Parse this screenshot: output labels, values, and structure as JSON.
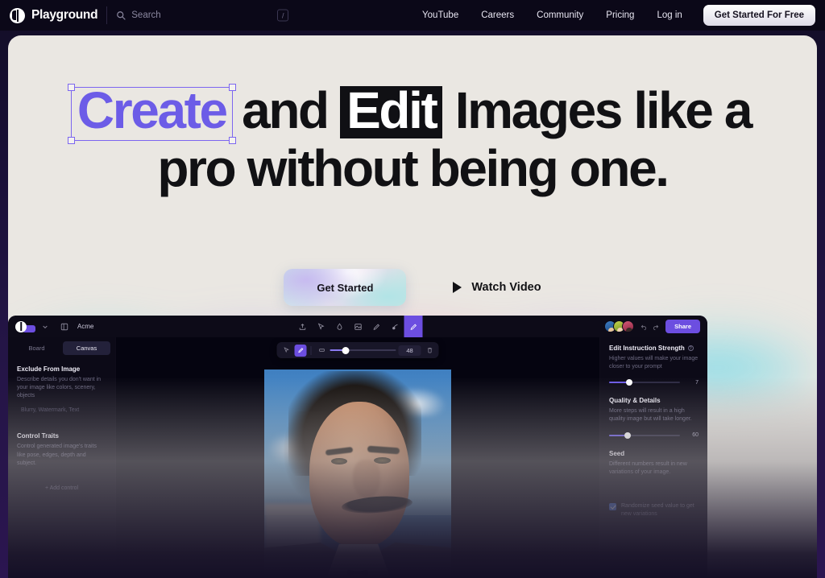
{
  "nav": {
    "brand": "Playground",
    "brand_logo_icon": "playground-logo-icon",
    "search": {
      "placeholder": "Search",
      "icon": "search-icon",
      "shortcut": "/"
    },
    "links": [
      {
        "label": "YouTube"
      },
      {
        "label": "Careers"
      },
      {
        "label": "Community"
      },
      {
        "label": "Pricing"
      },
      {
        "label": "Log in"
      }
    ],
    "cta": "Get Started For Free"
  },
  "hero": {
    "headline": {
      "word_create": "Create",
      "connector": "and",
      "word_edit": "Edit",
      "rest_line1": "Images like a",
      "line2": "pro without being one."
    },
    "primary_cta": "Get Started",
    "secondary_cta": "Watch Video",
    "secondary_cta_icon": "play-icon",
    "accent_color": "#6c5ce7",
    "selection_color": "#7c66f0",
    "card_bg": "#eae7e2"
  },
  "app": {
    "topbar": {
      "logo_icon": "app-logo-icon",
      "chevron_icon": "chevron-down-icon",
      "panel_icon": "panel-toggle-icon",
      "org": "Acme",
      "tools": [
        {
          "name": "export-icon",
          "active": false
        },
        {
          "name": "cursor-icon",
          "active": false
        },
        {
          "name": "eraser-icon",
          "active": false
        },
        {
          "name": "frame-icon",
          "active": false
        },
        {
          "name": "pen-icon",
          "active": false
        },
        {
          "name": "mask-icon",
          "active": false
        },
        {
          "name": "brush-icon",
          "active": true
        }
      ],
      "undo_icon": "undo-icon",
      "redo_icon": "redo-icon",
      "share": "Share",
      "avatars": [
        "avatar-1",
        "avatar-2",
        "avatar-3"
      ],
      "accent": "#6c4ee0"
    },
    "left_panel": {
      "tabs": [
        {
          "label": "Board",
          "active": false
        },
        {
          "label": "Canvas",
          "active": true
        }
      ],
      "sections": [
        {
          "title": "Exclude From Image",
          "desc": "Describe details you don't want in your image like colors, scenery, objects",
          "placeholder": "Blurry, Watermark, Text"
        },
        {
          "title": "Control Traits",
          "desc": "Control generated image's traits like pose, edges, depth and subject.",
          "action": "+ Add control"
        }
      ]
    },
    "canvas": {
      "floating_toolbar": {
        "cursor_icon": "cursor-icon",
        "brush_icon": "brush-icon",
        "size_icon": "brush-size-icon",
        "size_value": "48",
        "delete_icon": "trash-icon"
      },
      "image_alt": "portrait-of-man-with-mustache-by-the-sea"
    },
    "right_panel": {
      "sections": [
        {
          "title": "Edit Instruction Strength",
          "help_icon": "help-icon",
          "desc": "Higher values will make your image closer to your prompt",
          "value": "7",
          "percent": 28
        },
        {
          "title": "Quality & Details",
          "desc": "More steps will result in a high quality image but will take longer.",
          "value": "60",
          "percent": 26
        },
        {
          "title": "Seed",
          "desc": "Different numbers result in new variations of your image.",
          "checkbox_label": "Randomize seed value to get new variations",
          "checked": true
        }
      ]
    }
  }
}
